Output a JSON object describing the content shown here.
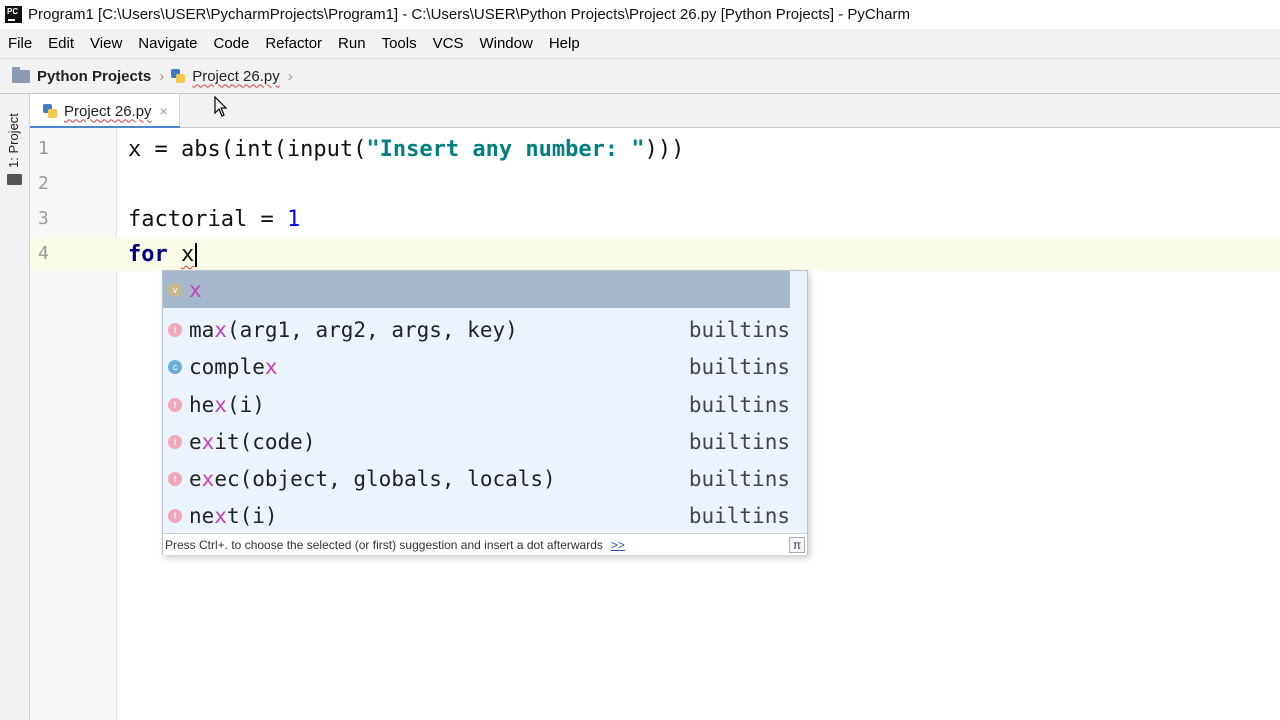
{
  "window": {
    "title": "Program1 [C:\\Users\\USER\\PycharmProjects\\Program1] - C:\\Users\\USER\\Python Projects\\Project 26.py [Python Projects] - PyCharm",
    "logo_text": "PC"
  },
  "menu": {
    "items": [
      {
        "label": "File"
      },
      {
        "label": "Edit"
      },
      {
        "label": "View"
      },
      {
        "label": "Navigate"
      },
      {
        "label": "Code"
      },
      {
        "label": "Refactor"
      },
      {
        "label": "Run"
      },
      {
        "label": "Tools"
      },
      {
        "label": "VCS"
      },
      {
        "label": "Window"
      },
      {
        "label": "Help"
      }
    ]
  },
  "breadcrumb": {
    "project": "Python Projects",
    "file": "Project 26.py"
  },
  "toolstrip": {
    "project_label": "1: Project"
  },
  "tabs": [
    {
      "label": "Project 26.py",
      "close": "×",
      "active": true
    }
  ],
  "editor": {
    "line_numbers": [
      "1",
      "2",
      "3",
      "4"
    ],
    "lines": {
      "l1": {
        "var": "x = abs(int(input(",
        "str": "\"Insert any number: \"",
        "end": ")))"
      },
      "l3": {
        "text": "factorial = ",
        "num": "1"
      },
      "l4": {
        "kw": "for",
        "var": "x"
      }
    }
  },
  "completion": {
    "items": [
      {
        "kind": "v",
        "pre": "",
        "match": "x",
        "post": "",
        "source": "",
        "selected": true
      },
      {
        "kind": "f",
        "pre": "ma",
        "match": "x",
        "post": "(arg1, arg2, args, key)",
        "source": "builtins"
      },
      {
        "kind": "c",
        "pre": "comple",
        "match": "x",
        "post": "",
        "source": "builtins"
      },
      {
        "kind": "f",
        "pre": "he",
        "match": "x",
        "post": "(i)",
        "source": "builtins"
      },
      {
        "kind": "f",
        "pre": "e",
        "match": "x",
        "post": "it(code)",
        "source": "builtins"
      },
      {
        "kind": "f",
        "pre": "e",
        "match": "x",
        "post": "ec(object, globals, locals)",
        "source": "builtins"
      },
      {
        "kind": "f",
        "pre": "ne",
        "match": "x",
        "post": "t(i)",
        "source": "builtins"
      }
    ],
    "hint": "Press Ctrl+. to choose the selected (or first) suggestion and insert a dot afterwards",
    "hint_link": ">>",
    "pi": "π"
  },
  "icons": {
    "app": "pycharm-logo",
    "folder": "folder-icon",
    "file": "python-file-icon",
    "close": "close-icon",
    "cursor": "mouse-pointer-icon"
  },
  "colors": {
    "keyword": "#000080",
    "string": "#008080",
    "number": "#0000ff",
    "match_highlight": "#c83dbb",
    "selection": "#a5b8cc",
    "popup_bg": "#ebf4fe"
  }
}
